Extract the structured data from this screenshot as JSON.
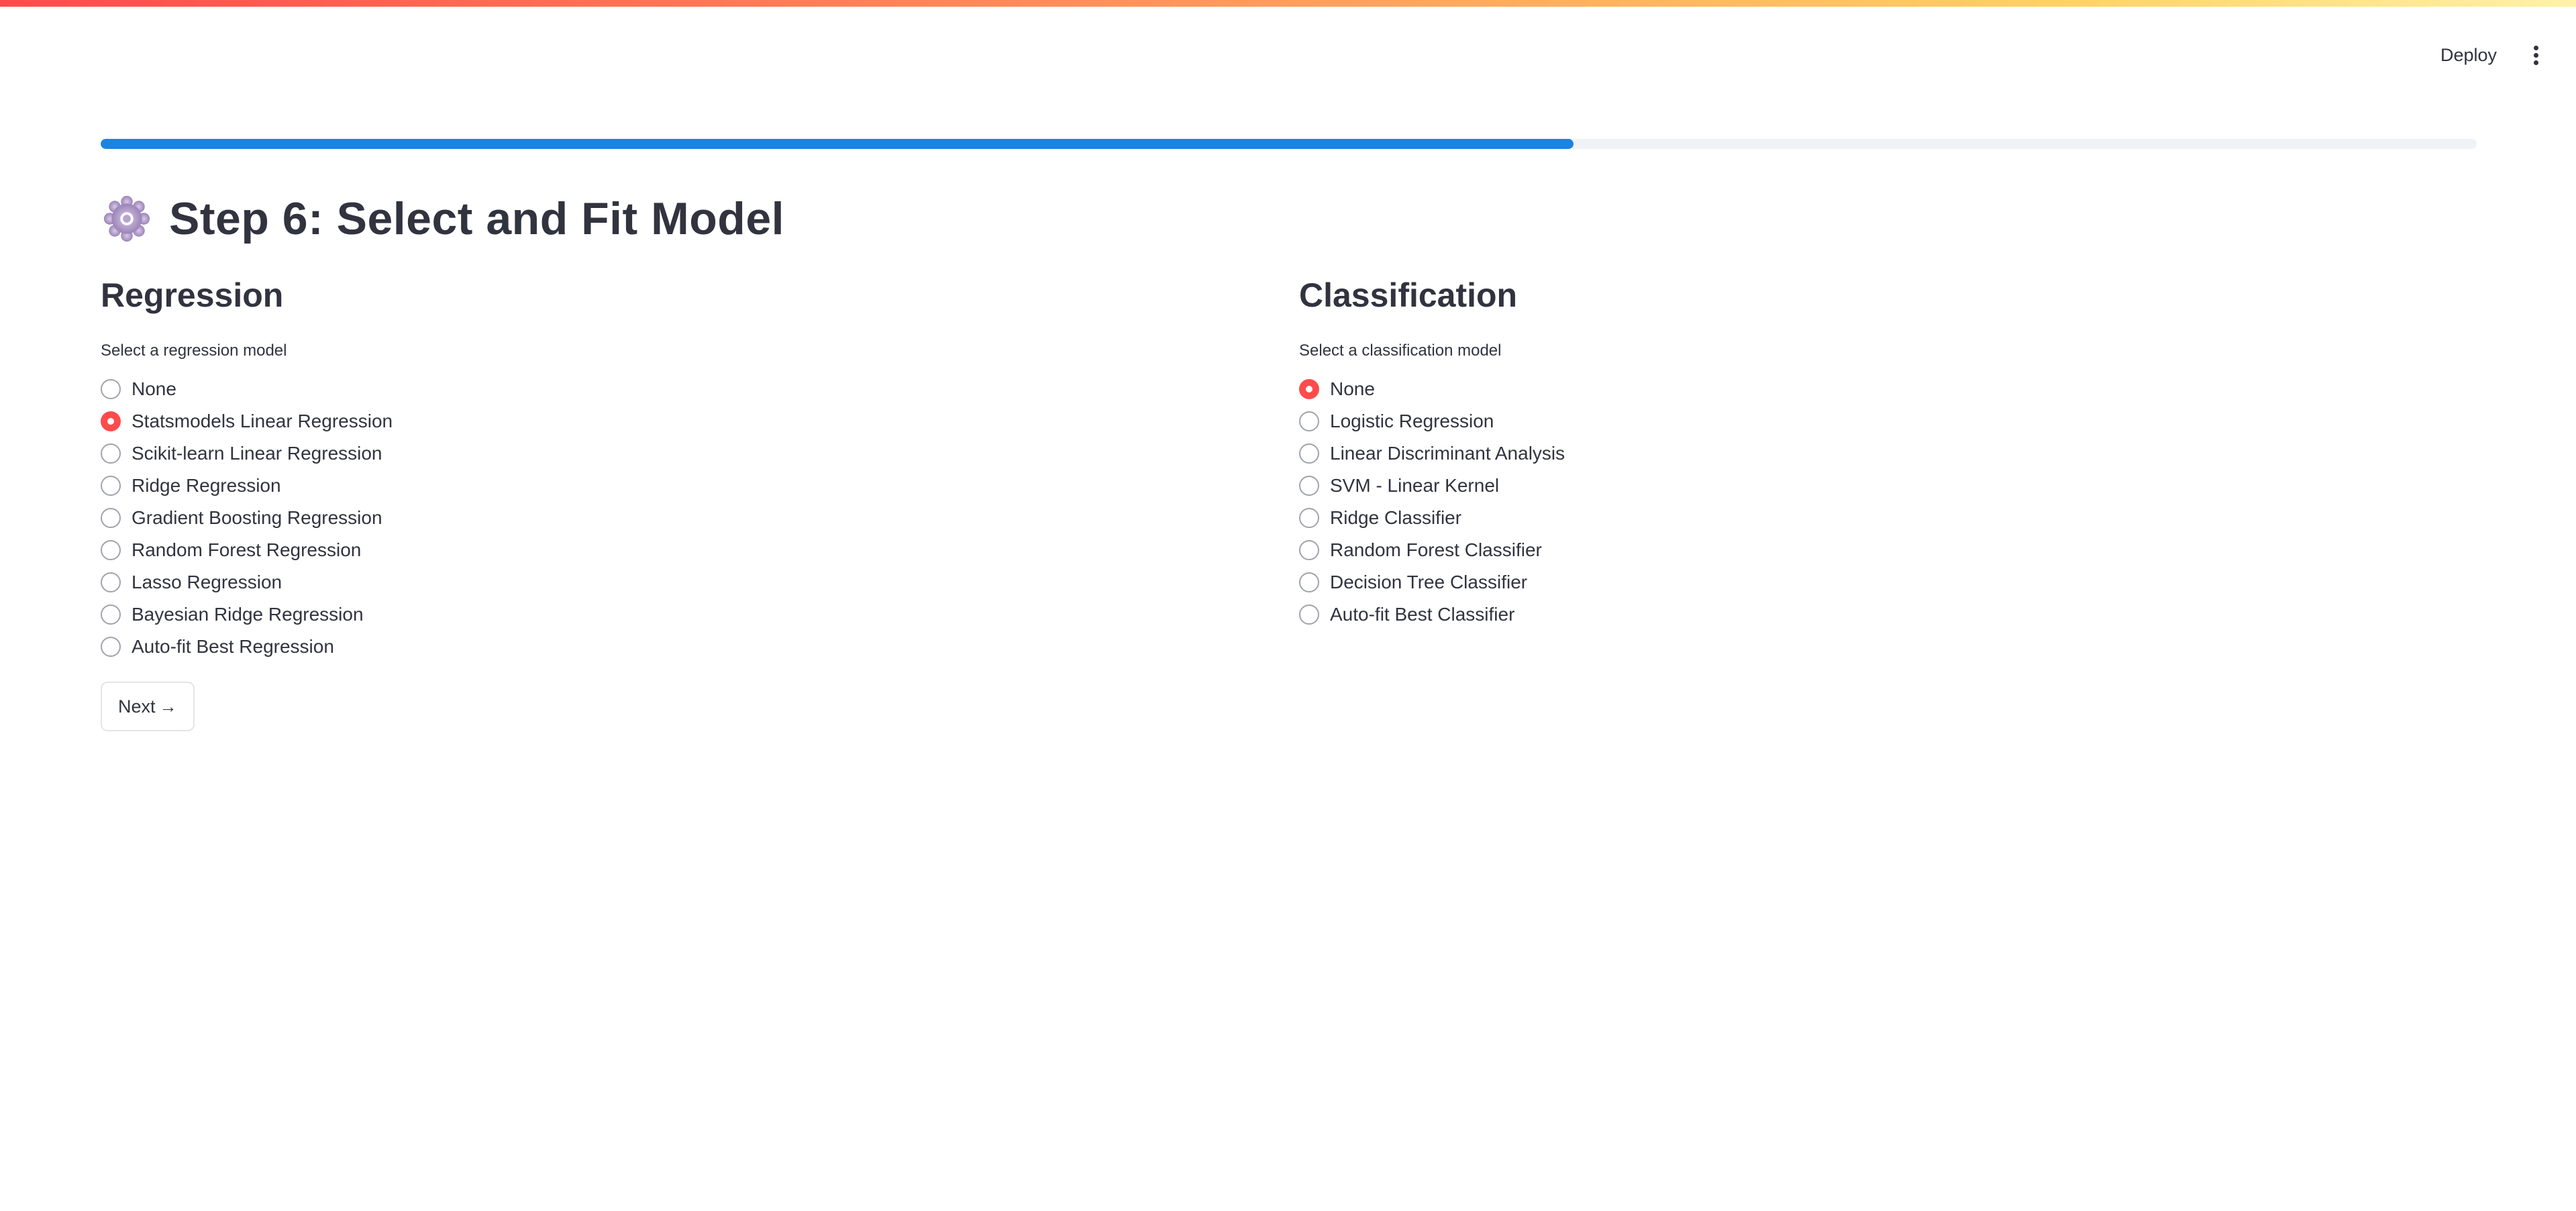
{
  "header": {
    "deploy_label": "Deploy",
    "menu_icon": "more-vertical-icon"
  },
  "progress": {
    "fraction": 0.62,
    "color": "#1c83e1"
  },
  "page": {
    "title_icon": "gear-icon",
    "title": "Step 6: Select and Fit Model"
  },
  "regression": {
    "heading": "Regression",
    "caption": "Select a regression model",
    "selected_index": 1,
    "options": [
      "None",
      "Statsmodels Linear Regression",
      "Scikit-learn Linear Regression",
      "Ridge Regression",
      "Gradient Boosting Regression",
      "Random Forest Regression",
      "Lasso Regression",
      "Bayesian Ridge Regression",
      "Auto-fit Best Regression"
    ]
  },
  "classification": {
    "heading": "Classification",
    "caption": "Select a classification model",
    "selected_index": 0,
    "options": [
      "None",
      "Logistic Regression",
      "Linear Discriminant Analysis",
      "SVM - Linear Kernel",
      "Ridge Classifier",
      "Random Forest Classifier",
      "Decision Tree Classifier",
      "Auto-fit Best Classifier"
    ]
  },
  "actions": {
    "next_label": "Next",
    "next_icon": "arrow-right-icon"
  },
  "colors": {
    "accent_selected": "#ff4b4b",
    "text": "#31333f"
  }
}
